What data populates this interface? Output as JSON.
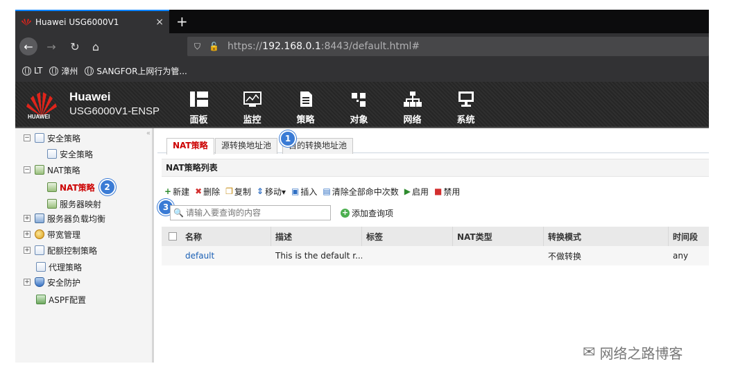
{
  "browser": {
    "tab_title": "Huawei USG6000V1",
    "tab_close": "×",
    "new_tab": "+",
    "url_scheme": "https://",
    "url_host": "192.168.0.1",
    "url_rest": ":8443/default.html#",
    "bookmarks": [
      {
        "label": "LT"
      },
      {
        "label": "漳州"
      },
      {
        "label": "SANGFOR上网行为管..."
      }
    ]
  },
  "app": {
    "brand_name": "Huawei",
    "model": "USG6000V1-ENSP",
    "logo_text": "HUAWEI",
    "nav": [
      {
        "label": "面板",
        "icon": "dashboard-icon"
      },
      {
        "label": "监控",
        "icon": "monitor-icon"
      },
      {
        "label": "策略",
        "icon": "policy-icon"
      },
      {
        "label": "对象",
        "icon": "object-icon"
      },
      {
        "label": "网络",
        "icon": "network-icon"
      },
      {
        "label": "系统",
        "icon": "system-icon"
      }
    ]
  },
  "sidebar": {
    "items": [
      {
        "label": "安全策略",
        "expander": "−"
      },
      {
        "label": "安全策略"
      },
      {
        "label": "NAT策略",
        "expander": "−"
      },
      {
        "label": "NAT策略"
      },
      {
        "label": "服务器映射"
      },
      {
        "label": "服务器负载均衡",
        "expander": "+"
      },
      {
        "label": "带宽管理",
        "expander": "+"
      },
      {
        "label": "配额控制策略",
        "expander": "+"
      },
      {
        "label": "代理策略"
      },
      {
        "label": "安全防护",
        "expander": "+"
      },
      {
        "label": "ASPF配置"
      }
    ],
    "collapse": "«"
  },
  "main": {
    "tabs": [
      {
        "label": "NAT策略"
      },
      {
        "label": "源转换地址池"
      },
      {
        "label": "目的转换地址池"
      }
    ],
    "section_title": "NAT策略列表",
    "toolbar": [
      {
        "label": "新建",
        "icon": "plus-icon",
        "sym": "+",
        "color": "#2e8b2e"
      },
      {
        "label": "删除",
        "icon": "delete-icon",
        "sym": "✖",
        "color": "#d32f2f"
      },
      {
        "label": "复制",
        "icon": "copy-icon",
        "sym": "❐",
        "color": "#c48a10"
      },
      {
        "label": "移动▾",
        "icon": "move-icon",
        "sym": "⇕",
        "color": "#2f6fc4"
      },
      {
        "label": "插入",
        "icon": "insert-icon",
        "sym": "▣",
        "color": "#2f6fc4"
      },
      {
        "label": "清除全部命中次数",
        "icon": "clear-hits-icon",
        "sym": "▤",
        "color": "#2f6fc4"
      },
      {
        "label": "启用",
        "icon": "enable-icon",
        "sym": "▶",
        "color": "#2e8b2e"
      },
      {
        "label": "禁用",
        "icon": "disable-icon",
        "sym": "■",
        "color": "#d32f2f"
      }
    ],
    "search": {
      "placeholder": "请输入要查询的内容"
    },
    "add_query": "添加查询项",
    "table": {
      "headers": [
        "名称",
        "描述",
        "标签",
        "NAT类型",
        "转换模式",
        "时间段"
      ],
      "rows": [
        [
          "default",
          "This is the default r...",
          "",
          "",
          "不做转换",
          "any"
        ]
      ]
    }
  },
  "annotations": [
    "1",
    "2",
    "3"
  ],
  "watermark": "网络之路博客"
}
